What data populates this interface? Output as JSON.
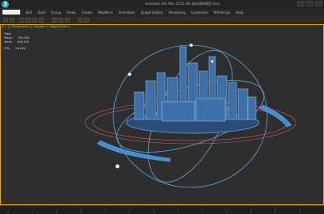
{
  "window": {
    "title": "Autodesk 3ds Max 2012 x64    城市建筑模型.max",
    "logo": "3"
  },
  "menu": {
    "items": [
      "Edit",
      "Tools",
      "Group",
      "Views",
      "Create",
      "Modifiers",
      "Animation",
      "Graph Editors",
      "Rendering",
      "Customize",
      "MAXScript",
      "Help"
    ]
  },
  "viewport": {
    "label": "[ + ] [ Perspective ] [ Shaded + Edged Faces ]",
    "stats": {
      "heading": "Total",
      "polys_label": "Polys:",
      "polys_value": "749,404",
      "verts_label": "Verts:",
      "verts_value": "449,192",
      "fps_label": "FPS:",
      "fps_value": "14.461"
    }
  },
  "colors": {
    "accent_border": "#d9a400",
    "wire": "#5aa9e6",
    "ring_red": "#d06060"
  }
}
